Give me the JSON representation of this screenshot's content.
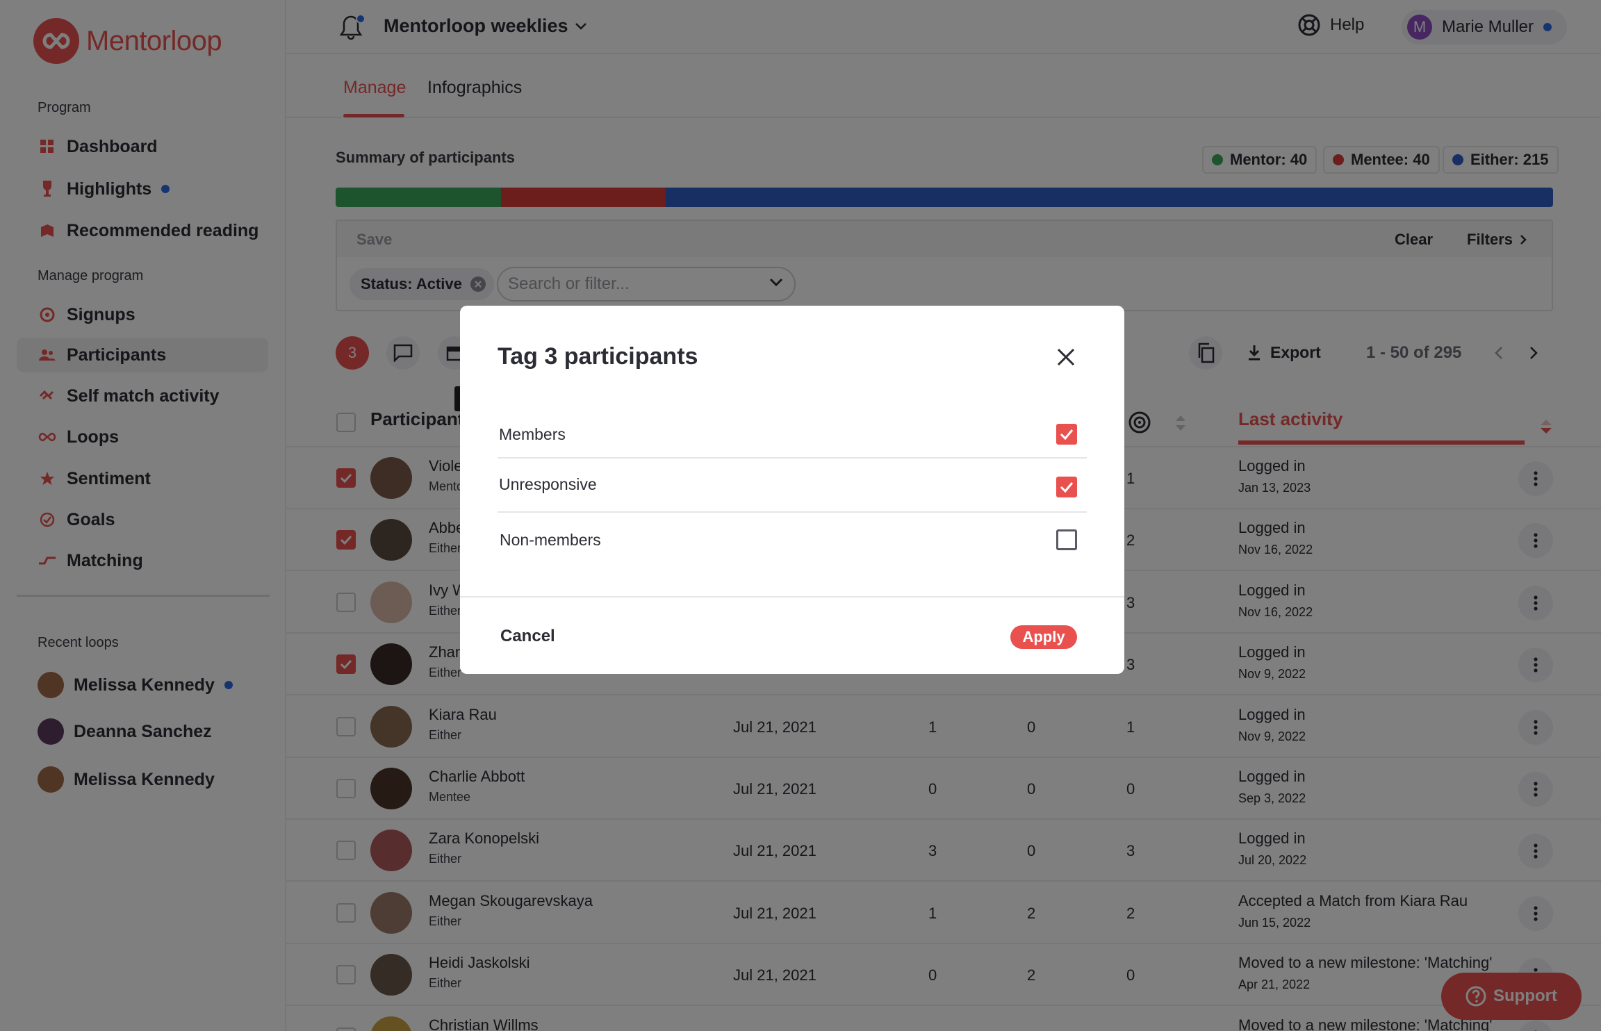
{
  "app": {
    "logo_text": "Mentorloop",
    "brand_color": "#e9514f"
  },
  "sidebar": {
    "program_heading": "Program",
    "program_items": [
      {
        "label": "Dashboard",
        "icon": "dashboard-icon"
      },
      {
        "label": "Highlights",
        "icon": "trophy-icon",
        "dot": true
      },
      {
        "label": "Recommended reading",
        "icon": "book-icon"
      }
    ],
    "manage_heading": "Manage program",
    "manage_items": [
      {
        "label": "Signups",
        "icon": "signup-icon"
      },
      {
        "label": "Participants",
        "icon": "participants-icon",
        "active": true
      },
      {
        "label": "Self match activity",
        "icon": "handshake-icon"
      },
      {
        "label": "Loops",
        "icon": "loop-icon"
      },
      {
        "label": "Sentiment",
        "icon": "star-icon"
      },
      {
        "label": "Goals",
        "icon": "goal-icon"
      },
      {
        "label": "Matching",
        "icon": "matching-icon"
      }
    ],
    "recent_heading": "Recent loops",
    "recent_loops": [
      {
        "label": "Melissa Kennedy",
        "dot": true
      },
      {
        "label": "Deanna Sanchez"
      },
      {
        "label": "Melissa Kennedy"
      }
    ]
  },
  "header": {
    "program_name": "Mentorloop weeklies",
    "help_label": "Help",
    "user_initial": "M",
    "user_name": "Marie Muller"
  },
  "tabs": [
    {
      "label": "Manage",
      "active": true
    },
    {
      "label": "Infographics"
    }
  ],
  "summary": {
    "title": "Summary of participants",
    "mentor_label": "Mentor: 40",
    "mentee_label": "Mentee: 40",
    "either_label": "Either: 215",
    "mentor_count": 40,
    "mentee_count": 40,
    "either_count": 215,
    "colors": {
      "mentor": "#3aa65a",
      "mentee": "#d93d3b",
      "either": "#2f5fc4"
    }
  },
  "filter": {
    "save_label": "Save",
    "clear_label": "Clear",
    "filters_label": "Filters",
    "chip_label": "Status: Active",
    "search_placeholder": "Search or filter..."
  },
  "toolbar": {
    "selected_count": "3",
    "export_label": "Export",
    "pager_text": "1 - 50 of 295"
  },
  "table": {
    "participant_header": "Participant",
    "last_activity_header": "Last activity",
    "rows": [
      {
        "name": "Viole",
        "role": "Mento",
        "date": "",
        "n1": "",
        "n2": "",
        "n3": "1",
        "activity": "Logged in",
        "activity_date": "Jan 13, 2023",
        "checked": true
      },
      {
        "name": "Abbe",
        "role": "Either",
        "date": "",
        "n1": "",
        "n2": "",
        "n3": "2",
        "activity": "Logged in",
        "activity_date": "Nov 16, 2022",
        "checked": true
      },
      {
        "name": "Ivy W",
        "role": "Either",
        "date": "",
        "n1": "",
        "n2": "",
        "n3": "3",
        "activity": "Logged in",
        "activity_date": "Nov 16, 2022",
        "checked": false
      },
      {
        "name": "Zhan",
        "role": "Either",
        "date": "",
        "n1": "",
        "n2": "",
        "n3": "3",
        "activity": "Logged in",
        "activity_date": "Nov 9, 2022",
        "checked": true
      },
      {
        "name": "Kiara Rau",
        "role": "Either",
        "date": "Jul 21, 2021",
        "n1": "1",
        "n2": "0",
        "n3": "1",
        "activity": "Logged in",
        "activity_date": "Nov 9, 2022",
        "checked": false
      },
      {
        "name": "Charlie Abbott",
        "role": "Mentee",
        "date": "Jul 21, 2021",
        "n1": "0",
        "n2": "0",
        "n3": "0",
        "activity": "Logged in",
        "activity_date": "Sep 3, 2022",
        "checked": false
      },
      {
        "name": "Zara Konopelski",
        "role": "Either",
        "date": "Jul 21, 2021",
        "n1": "3",
        "n2": "0",
        "n3": "3",
        "activity": "Logged in",
        "activity_date": "Jul 20, 2022",
        "checked": false
      },
      {
        "name": "Megan Skougarevskaya",
        "role": "Either",
        "date": "Jul 21, 2021",
        "n1": "1",
        "n2": "2",
        "n3": "2",
        "activity": "Accepted a Match from Kiara Rau",
        "activity_date": "Jun 15, 2022",
        "checked": false
      },
      {
        "name": "Heidi Jaskolski",
        "role": "Either",
        "date": "Jul 21, 2021",
        "n1": "0",
        "n2": "2",
        "n3": "0",
        "activity": "Moved to a new milestone: 'Matching'",
        "activity_date": "Apr 21, 2022",
        "checked": false
      },
      {
        "name": "Christian Willms",
        "role": "",
        "date": "",
        "n1": "",
        "n2": "",
        "n3": "",
        "activity": "Moved to a new milestone: 'Matching'",
        "activity_date": "",
        "checked": false
      }
    ]
  },
  "support_label": "Support",
  "modal": {
    "title": "Tag 3 participants",
    "options": [
      {
        "label": "Members",
        "checked": true
      },
      {
        "label": "Unresponsive",
        "checked": true
      },
      {
        "label": "Non-members",
        "checked": false
      }
    ],
    "cancel_label": "Cancel",
    "apply_label": "Apply"
  }
}
